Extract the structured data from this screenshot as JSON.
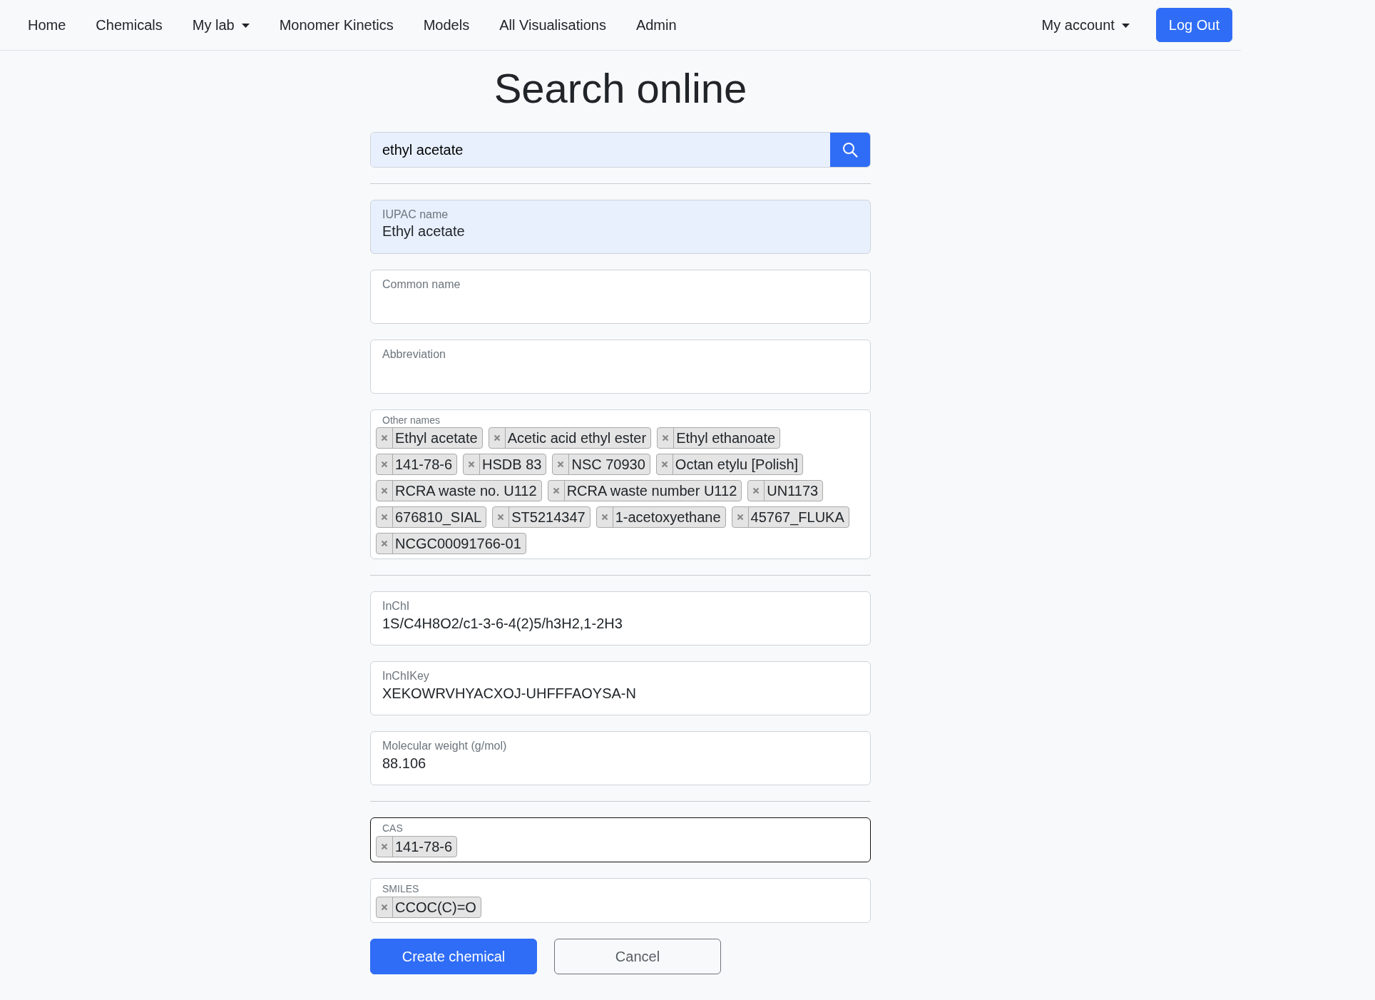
{
  "nav": {
    "items": [
      {
        "label": "Home",
        "dropdown": false
      },
      {
        "label": "Chemicals",
        "dropdown": false
      },
      {
        "label": "My lab",
        "dropdown": true
      },
      {
        "label": "Monomer Kinetics",
        "dropdown": false
      },
      {
        "label": "Models",
        "dropdown": false
      },
      {
        "label": "All Visualisations",
        "dropdown": false
      },
      {
        "label": "Admin",
        "dropdown": false
      }
    ],
    "account": {
      "label": "My account",
      "dropdown": true
    },
    "logout": "Log Out"
  },
  "title": "Search online",
  "search": {
    "value": "ethyl acetate",
    "highlighted": true
  },
  "sections": [
    [
      {
        "kind": "text",
        "label": "IUPAC name",
        "value": "Ethyl acetate",
        "highlighted": true,
        "focused": false
      },
      {
        "kind": "text",
        "label": "Common name",
        "highlighted": false,
        "focused": false
      },
      {
        "kind": "text",
        "label": "Abbreviation",
        "highlighted": false,
        "focused": false
      },
      {
        "kind": "tags",
        "label": "Other names",
        "highlighted": false,
        "focused": false,
        "tags": [
          "Ethyl acetate",
          "Acetic acid ethyl ester",
          "Ethyl ethanoate",
          "141-78-6",
          "HSDB 83",
          "NSC 70930",
          "Octan etylu [Polish]",
          "RCRA waste no. U112",
          "RCRA waste number U112",
          "UN1173",
          "676810_SIAL",
          "ST5214347",
          "1-acetoxyethane",
          "45767_FLUKA",
          "NCGC00091766-01"
        ]
      }
    ],
    [
      {
        "kind": "text",
        "label": "InChI",
        "value": "1S/C4H8O2/c1-3-6-4(2)5/h3H2,1-2H3",
        "highlighted": false,
        "focused": false
      },
      {
        "kind": "text",
        "label": "InChIKey",
        "value": "XEKOWRVHYACXOJ-UHFFFAOYSA-N",
        "highlighted": false,
        "focused": false
      },
      {
        "kind": "text",
        "label": "Molecular weight (g/mol)",
        "value": "88.106",
        "highlighted": false,
        "focused": false
      }
    ],
    [
      {
        "kind": "tags",
        "label": "CAS",
        "highlighted": false,
        "focused": true,
        "tags": [
          "141-78-6"
        ]
      },
      {
        "kind": "tags",
        "label": "SMILES",
        "highlighted": false,
        "focused": false,
        "tags": [
          "CCOC(C)=O"
        ]
      }
    ]
  ],
  "buttons": [
    {
      "label": "Create chemical",
      "kind": "primary"
    },
    {
      "label": "Cancel",
      "kind": "secondary"
    }
  ]
}
